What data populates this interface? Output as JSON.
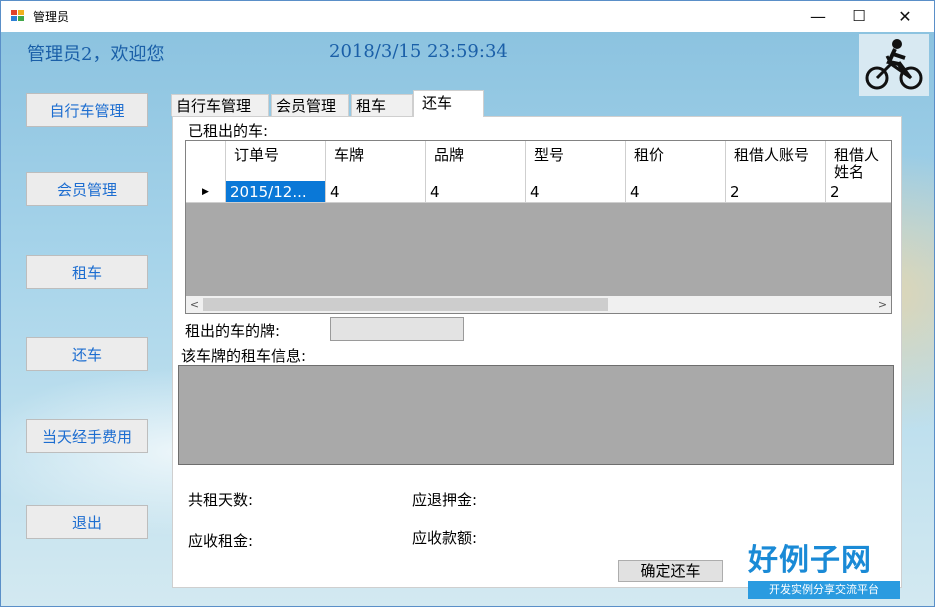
{
  "window": {
    "title": "管理员",
    "minimize": "—",
    "maximize": "☐",
    "close": "✕"
  },
  "header": {
    "welcome": "管理员2，欢迎您",
    "datetime": "2018/3/15  23:59:34"
  },
  "sidebar": {
    "buttons": [
      "自行车管理",
      "会员管理",
      "租车",
      "还车",
      "当天经手费用",
      "退出"
    ]
  },
  "tabs": [
    {
      "label": "自行车管理",
      "active": false
    },
    {
      "label": "会员管理",
      "active": false
    },
    {
      "label": "租车",
      "active": false
    },
    {
      "label": "还车",
      "active": true
    }
  ],
  "panel": {
    "rented_label": "已租出的车:",
    "grid": {
      "columns": [
        "订单号",
        "车牌",
        "品牌",
        "型号",
        "租价",
        "租借人账号",
        "租借人姓名"
      ],
      "rows": [
        [
          "2015/12...",
          "4",
          "4",
          "4",
          "4",
          "2",
          "2"
        ]
      ]
    },
    "plate_label": "租出的车的牌:",
    "info_label": "该车牌的租车信息:",
    "days_label": "共租天数:",
    "deposit_refund_label": "应退押金:",
    "rent_label": "应收租金:",
    "amount_label": "应收款额:",
    "confirm_button": "确定还车"
  },
  "brand": {
    "title": "好例子网",
    "subtitle": "开发实例分享交流平台"
  }
}
